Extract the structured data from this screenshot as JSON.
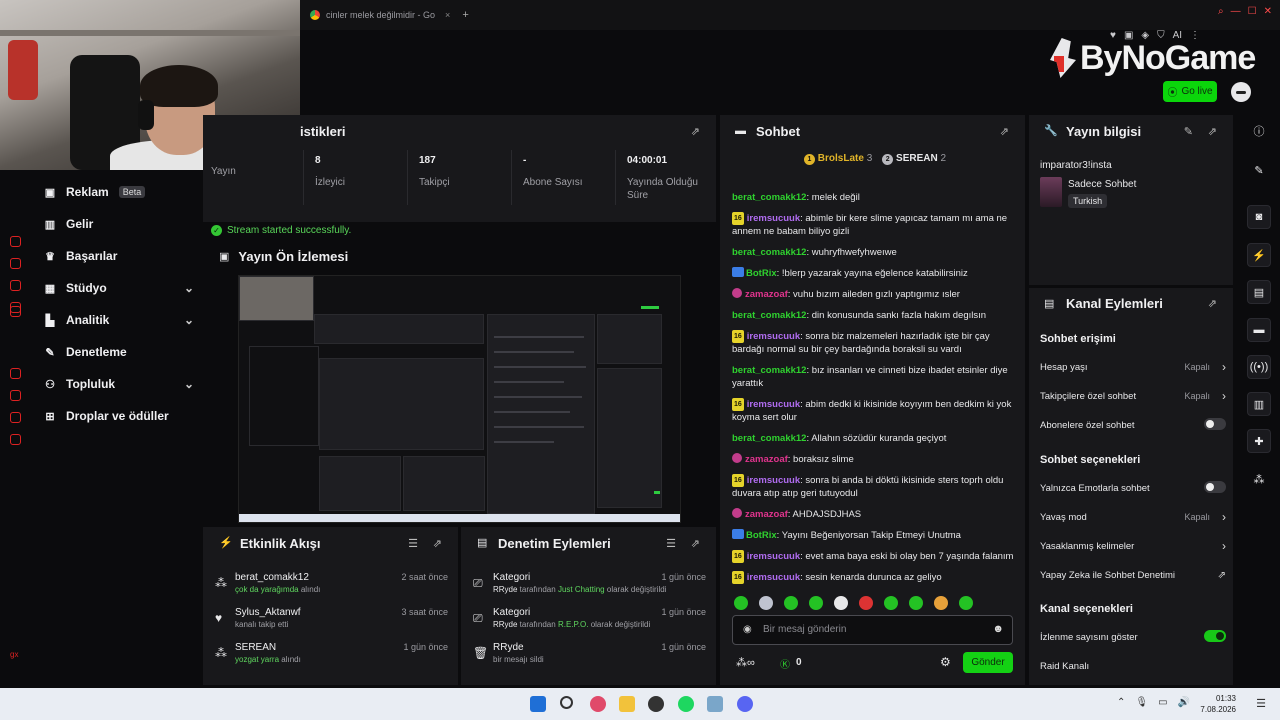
{
  "browser": {
    "tab_title": "cinler melek değilmidir - Go",
    "new_tab": "+",
    "tab_close": "×",
    "ext_label": "AI"
  },
  "logo": {
    "text": "ByNoGame"
  },
  "header": {
    "go_live": "Go live"
  },
  "sidebar": {
    "items": [
      {
        "label": "Reklam",
        "badge": "Beta",
        "icon": "ad-icon"
      },
      {
        "label": "Gelir",
        "icon": "income-icon"
      },
      {
        "label": "Başarılar",
        "icon": "trophy-icon"
      },
      {
        "label": "Stüdyo",
        "icon": "studio-icon",
        "expandable": true
      },
      {
        "label": "Analitik",
        "icon": "chart-icon",
        "expandable": true
      },
      {
        "label": "Denetleme",
        "icon": "moderation-icon"
      },
      {
        "label": "Topluluk",
        "icon": "community-icon",
        "expandable": true
      },
      {
        "label": "Droplar ve ödüller",
        "icon": "gift-icon"
      }
    ],
    "rail_label": "gx"
  },
  "stats": {
    "title": "istikleri",
    "items": [
      {
        "value": "",
        "label": "Yayın"
      },
      {
        "value": "8",
        "label": "İzleyici"
      },
      {
        "value": "187",
        "label": "Takipçi"
      },
      {
        "value": "-",
        "label": "Abone Sayısı"
      },
      {
        "value": "04:00:01",
        "label": "Yayında Olduğu Süre"
      }
    ],
    "success": "Stream started successfully."
  },
  "preview": {
    "title": "Yayın Ön İzlemesi"
  },
  "activity": {
    "title": "Etkinlik Akışı",
    "items": [
      {
        "name": "berat_comakk12",
        "sub_green": "çok da yarağımda",
        "sub_rest": " alındı",
        "time": "2 saat önce",
        "icon": "gift-icon"
      },
      {
        "name": "Sylus_Aktanwf",
        "sub_green": "",
        "sub_rest": "kanalı takip etti",
        "time": "3 saat önce",
        "icon": "heart-icon"
      },
      {
        "name": "SEREAN",
        "sub_green": "yozgat yarra",
        "sub_rest": " alındı",
        "time": "1 gün önce",
        "icon": "gift-icon"
      }
    ]
  },
  "moderation": {
    "title": "Denetim Eylemleri",
    "items": [
      {
        "name": "Kategori",
        "sub_pre": "RRyde",
        "sub_mid": " tarafından ",
        "sub_green": "Just Chatting",
        "sub_post": " olarak değiştirildi",
        "time": "1 gün önce"
      },
      {
        "name": "Kategori",
        "sub_pre": "RRyde",
        "sub_mid": " tarafından ",
        "sub_green": "R.E.P.O.",
        "sub_post": " olarak değiştirildi",
        "time": "1 gün önce"
      },
      {
        "name": "RRyde",
        "sub_pre": "",
        "sub_mid": "bir mesajı sildi",
        "sub_green": "",
        "sub_post": "",
        "time": "1 gün önce"
      }
    ]
  },
  "chat": {
    "title": "Sohbet",
    "leaders": [
      {
        "rank": "1",
        "name": "BrolsLate",
        "count": "3",
        "color": "#e0b429"
      },
      {
        "rank": "2",
        "name": "SEREAN",
        "count": "2",
        "color": "#b8b8be"
      }
    ],
    "messages": [
      {
        "badge": "none",
        "user": "berat_comakk12",
        "color": "#2fd12f",
        "text": ": melek değil"
      },
      {
        "badge": "sub",
        "badge_text": "16",
        "user": "iremsucuuk",
        "color": "#b06cf0",
        "text": ": abimle bir kere slime yapıcaz tamam mı ama ne annem ne babam biliyo gizli"
      },
      {
        "badge": "none",
        "user": "berat_comakk12",
        "color": "#2fd12f",
        "text": ": wuhryfhwefyhweıwe"
      },
      {
        "badge": "bot",
        "user": "BotRix",
        "color": "#2fd12f",
        "text": ": !blerp yazarak yayına eğelence katabilirsiniz"
      },
      {
        "badge": "pink",
        "user": "zamazoaf",
        "color": "#e0348d",
        "text": ": vuhu bızım aileden gızlı yaptıgımız ısler"
      },
      {
        "badge": "none",
        "user": "berat_comakk12",
        "color": "#2fd12f",
        "text": ": din konusunda sankı fazla hakım degılsın"
      },
      {
        "badge": "sub",
        "badge_text": "16",
        "user": "iremsucuuk",
        "color": "#b06cf0",
        "text": ": sonra biz malzemeleri hazırladık işte bir çay bardağı normal su bir çey bardağında boraksli su vardı"
      },
      {
        "badge": "none",
        "user": "berat_comakk12",
        "color": "#2fd12f",
        "text": ": bız insanları ve cinneti bize ibadet etsinler diye yarattık"
      },
      {
        "badge": "sub",
        "badge_text": "16",
        "user": "iremsucuuk",
        "color": "#b06cf0",
        "text": ": abim dedki ki ikisinide koyıyım ben dedkim ki yok koyma sert olur"
      },
      {
        "badge": "none",
        "user": "berat_comakk12",
        "color": "#2fd12f",
        "text": ": Allahın sözüdür kuranda geçiyot"
      },
      {
        "badge": "pink",
        "user": "zamazoaf",
        "color": "#e0348d",
        "text": ": boraksız slime"
      },
      {
        "badge": "sub",
        "badge_text": "16",
        "user": "iremsucuuk",
        "color": "#b06cf0",
        "text": ": sonra bi anda bi döktü ikisinide sters toprh oldu duvara atıp atıp geri tutuyodul"
      },
      {
        "badge": "pink",
        "user": "zamazoaf",
        "color": "#e0348d",
        "text": ": AHDAJSDJHAS"
      },
      {
        "badge": "bot",
        "user": "BotRix",
        "color": "#2fd12f",
        "text": ": Yayını Beğeniyorsan Takip Etmeyi Unutma"
      },
      {
        "badge": "sub",
        "badge_text": "16",
        "user": "iremsucuuk",
        "color": "#b06cf0",
        "text": ": evet ama baya eski bi olay ben 7 yaşında falanım"
      },
      {
        "badge": "sub",
        "badge_text": "16",
        "user": "iremsucuuk",
        "color": "#b06cf0",
        "text": ": sesin kenarda durunca az geliyo"
      }
    ],
    "input_placeholder": "Bir mesaj gönderin",
    "footer_count": "0",
    "send": "Gönder"
  },
  "info": {
    "title": "Yayın bilgisi",
    "stream_title": "imparator3!insta",
    "category": "Sadece Sohbet",
    "tag": "Turkish"
  },
  "actions": {
    "title": "Kanal Eylemleri",
    "section1": "Sohbet erişimi",
    "rows1": [
      {
        "label": "Hesap yaşı",
        "value": "Kapalı",
        "kind": "chevron"
      },
      {
        "label": "Takipçilere özel sohbet",
        "value": "Kapalı",
        "kind": "chevron"
      },
      {
        "label": "Abonelere özel sohbet",
        "value": "",
        "kind": "toggle-off"
      }
    ],
    "section2": "Sohbet seçenekleri",
    "rows2": [
      {
        "label": "Yalnızca Emotlarla sohbet",
        "value": "",
        "kind": "toggle-off"
      },
      {
        "label": "Yavaş mod",
        "value": "Kapalı",
        "kind": "chevron"
      },
      {
        "label": "Yasaklanmış kelimeler",
        "value": "",
        "kind": "chevron"
      },
      {
        "label": "Yapay Zeka ile Sohbet Denetimi",
        "value": "",
        "kind": "external"
      }
    ],
    "section3": "Kanal seçenekleri",
    "rows3": [
      {
        "label": "İzlenme sayısını göster",
        "value": "",
        "kind": "toggle-on"
      },
      {
        "label": "Raid Kanalı",
        "value": "",
        "kind": "none"
      }
    ]
  },
  "taskbar": {
    "time": "01:33",
    "date": "7.08.2026"
  },
  "colors": {
    "accent": "#14d114",
    "panel": "#18181b",
    "bg": "#0b0b0d"
  }
}
